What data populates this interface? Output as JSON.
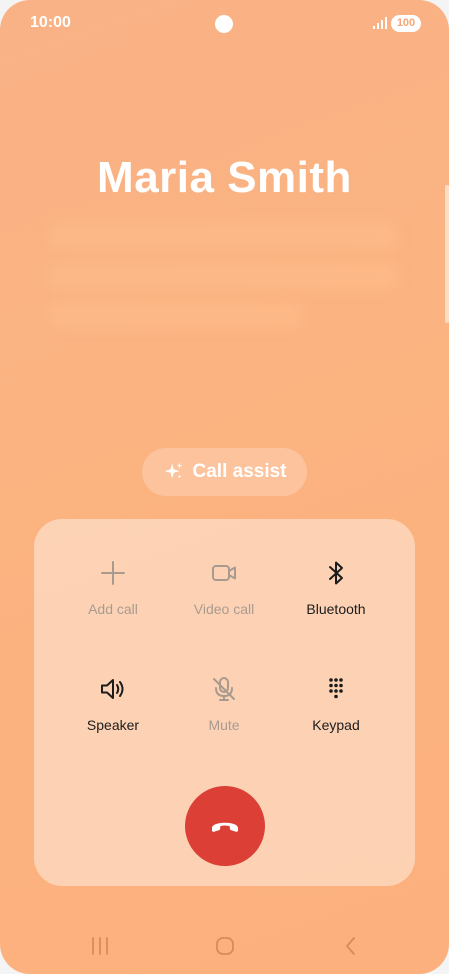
{
  "status_bar": {
    "time": "10:00",
    "battery": "100",
    "icons": [
      "camera-hole",
      "signal-icon",
      "battery-badge"
    ]
  },
  "caller": {
    "name": "Maria Smith"
  },
  "call_assist": {
    "label": "Call assist",
    "icon": "sparkle-icon"
  },
  "controls": [
    {
      "label": "Add call",
      "icon": "plus-icon",
      "enabled": false
    },
    {
      "label": "Video call",
      "icon": "video-camera-icon",
      "enabled": false
    },
    {
      "label": "Bluetooth",
      "icon": "bluetooth-icon",
      "enabled": true
    },
    {
      "label": "Speaker",
      "icon": "speaker-icon",
      "enabled": true
    },
    {
      "label": "Mute",
      "icon": "microphone-muted-icon",
      "enabled": false
    },
    {
      "label": "Keypad",
      "icon": "keypad-icon",
      "enabled": true
    }
  ],
  "end_call": {
    "icon": "phone-hangup-icon",
    "color": "#db3f36"
  },
  "nav": {
    "icons": [
      "recent-apps-icon",
      "home-icon",
      "back-icon"
    ]
  },
  "colors": {
    "background": "#fbb381",
    "end_call": "#db3f36",
    "disabled_text": "#a99a90"
  }
}
